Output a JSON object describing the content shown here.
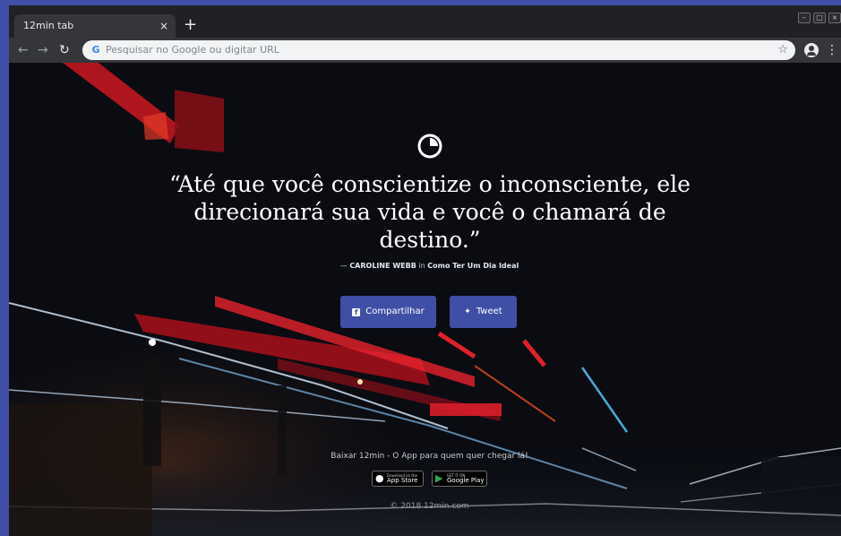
{
  "browser": {
    "tab_title": "12min tab",
    "tab_close": "×",
    "new_tab": "+",
    "omnibox_placeholder": "Pesquisar no Google ou digitar URL",
    "window_controls": [
      "–",
      "□",
      "×"
    ]
  },
  "page": {
    "quote": "“Até que você conscientize o inconsciente, ele direcionará sua vida e você o chamará de destino.”",
    "attribution_prefix": "— ",
    "author": "CAROLINE WEBB",
    "attribution_in": " in ",
    "book": "Como Ter Um Dia Ideal",
    "share_button": "Compartilhar",
    "tweet_button": "Tweet",
    "download_text": "Baixar 12min - O App para quem quer chegar lá!",
    "app_store_small": "Download on the",
    "app_store_name": "App Store",
    "google_play_small": "GET IT ON",
    "google_play_name": "Google Play",
    "copyright": "© 2018 12min.com"
  },
  "colors": {
    "accent": "#3f4fa6",
    "background": "#0b0d14"
  }
}
